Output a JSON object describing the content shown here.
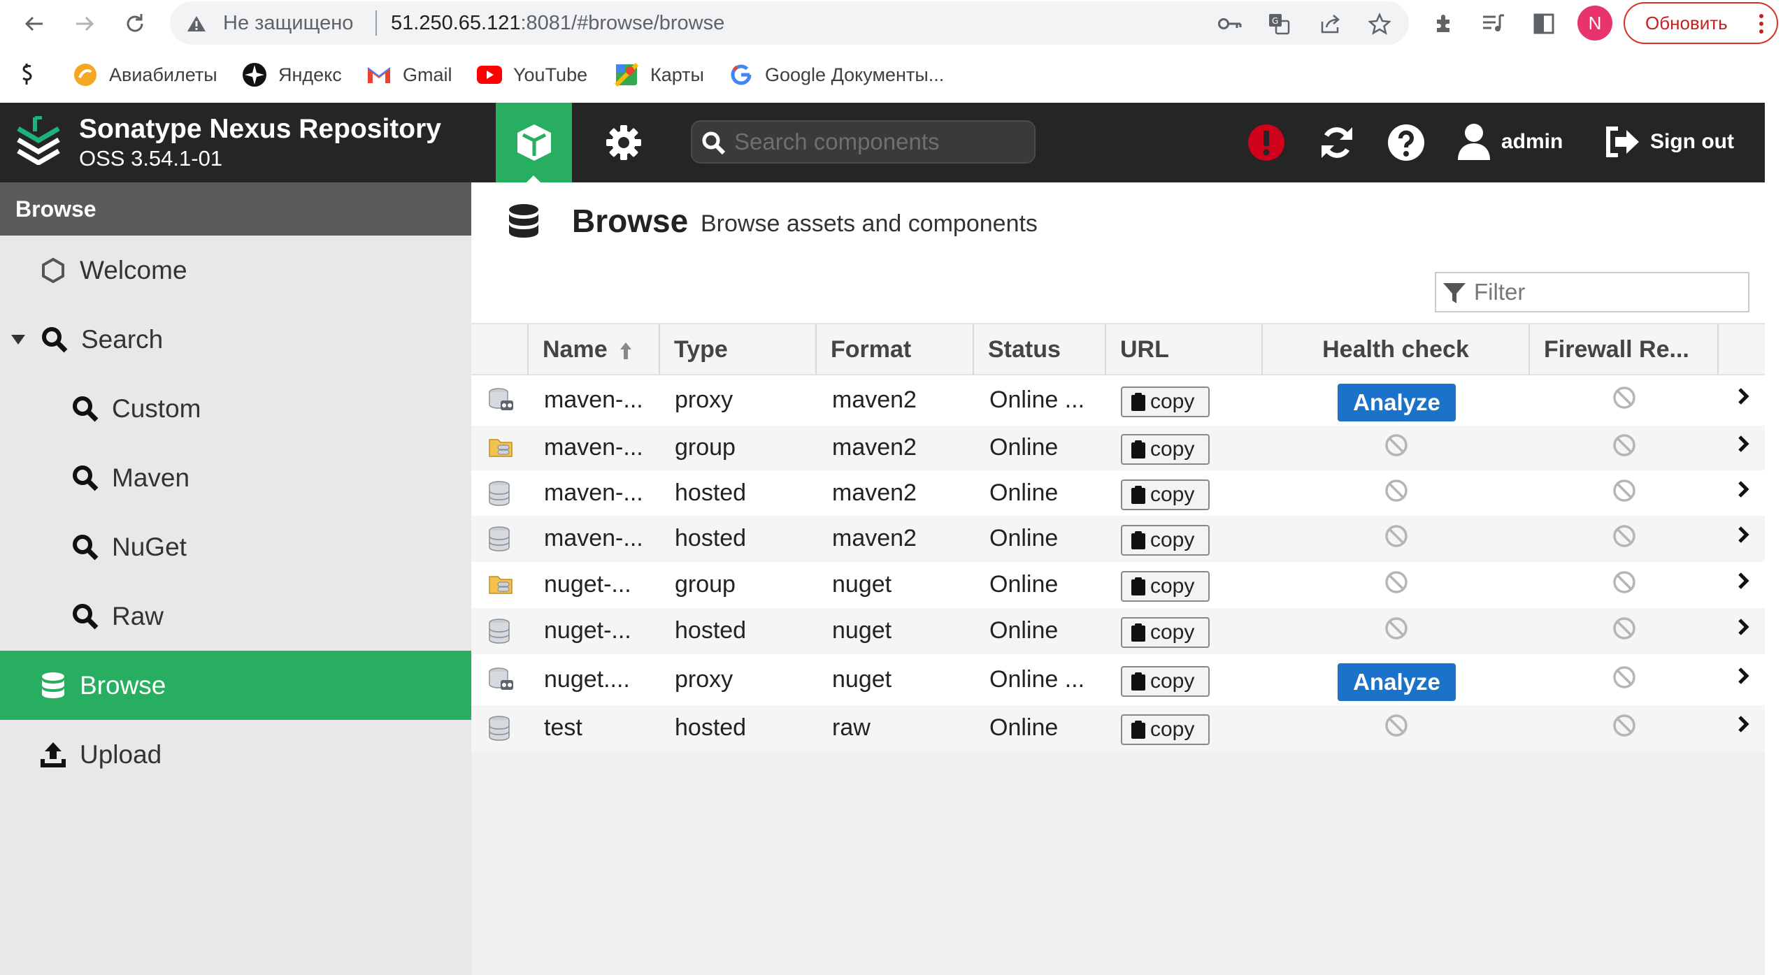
{
  "browser": {
    "security_label": "Не защищено",
    "url_host": "51.250.65.121",
    "url_rest": ":8081/#browse/browse",
    "update_label": "Обновить",
    "profile_initial": "N"
  },
  "bookmarks": [
    {
      "label": "Авиабилеты",
      "icon": "aviasales-icon"
    },
    {
      "label": "Яндекс",
      "icon": "yandex-icon"
    },
    {
      "label": "Gmail",
      "icon": "gmail-icon"
    },
    {
      "label": "YouTube",
      "icon": "youtube-icon"
    },
    {
      "label": "Карты",
      "icon": "maps-icon"
    },
    {
      "label": "Google Документы...",
      "icon": "google-icon"
    }
  ],
  "header": {
    "title": "Sonatype Nexus Repository",
    "version": "OSS 3.54.1-01",
    "search_placeholder": "Search components",
    "user": "admin",
    "signout": "Sign out"
  },
  "sidebar": {
    "title": "Browse",
    "items": [
      {
        "label": "Welcome",
        "icon": "hexagon-icon"
      },
      {
        "label": "Search",
        "icon": "search-icon",
        "expanded": true
      },
      {
        "label": "Custom",
        "icon": "search-icon"
      },
      {
        "label": "Maven",
        "icon": "search-icon"
      },
      {
        "label": "NuGet",
        "icon": "search-icon"
      },
      {
        "label": "Raw",
        "icon": "search-icon"
      },
      {
        "label": "Browse",
        "icon": "database-icon",
        "active": true
      },
      {
        "label": "Upload",
        "icon": "upload-icon"
      }
    ]
  },
  "main": {
    "title": "Browse",
    "subtitle": "Browse assets and components",
    "filter_placeholder": "Filter",
    "columns": [
      "Name",
      "Type",
      "Format",
      "Status",
      "URL",
      "Health check",
      "Firewall Re..."
    ],
    "copy_label": "copy",
    "analyze_label": "Analyze",
    "rows": [
      {
        "name": "maven-...",
        "type": "proxy",
        "format": "maven2",
        "status": "Online ...",
        "icon": "proxy-repo-icon",
        "health": "analyze"
      },
      {
        "name": "maven-...",
        "type": "group",
        "format": "maven2",
        "status": "Online",
        "icon": "group-repo-icon",
        "health": "disabled"
      },
      {
        "name": "maven-...",
        "type": "hosted",
        "format": "maven2",
        "status": "Online",
        "icon": "hosted-repo-icon",
        "health": "disabled"
      },
      {
        "name": "maven-...",
        "type": "hosted",
        "format": "maven2",
        "status": "Online",
        "icon": "hosted-repo-icon",
        "health": "disabled"
      },
      {
        "name": "nuget-...",
        "type": "group",
        "format": "nuget",
        "status": "Online",
        "icon": "group-repo-icon",
        "health": "disabled"
      },
      {
        "name": "nuget-...",
        "type": "hosted",
        "format": "nuget",
        "status": "Online",
        "icon": "hosted-repo-icon",
        "health": "disabled"
      },
      {
        "name": "nuget....",
        "type": "proxy",
        "format": "nuget",
        "status": "Online ...",
        "icon": "proxy-repo-icon",
        "health": "analyze"
      },
      {
        "name": "test",
        "type": "hosted",
        "format": "raw",
        "status": "Online",
        "icon": "hosted-repo-icon",
        "health": "disabled"
      }
    ]
  },
  "colors": {
    "header_bg": "#252525",
    "accent_green": "#27ae60",
    "analyze_blue": "#1a73c8",
    "sidebar_bg": "#e8e8e8"
  }
}
